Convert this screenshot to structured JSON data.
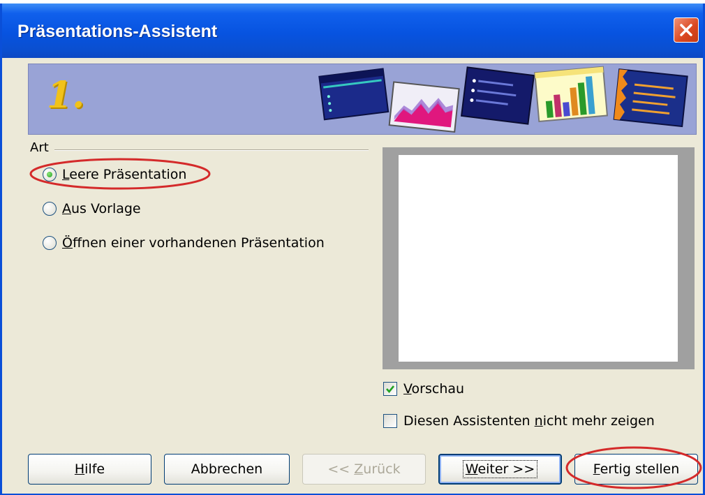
{
  "window": {
    "title": "Präsentations-Assistent"
  },
  "banner": {
    "step_number": "1.",
    "thumbnail_icons": [
      "presentation-dark-blue-slide-icon",
      "area-chart-slide-icon",
      "bullet-list-slide-icon",
      "bar-chart-slide-icon",
      "text-lines-slide-icon"
    ]
  },
  "type_group": {
    "label": "Art",
    "options": [
      {
        "label": "Leere Präsentation",
        "mnemonic_index": 0,
        "checked": true
      },
      {
        "label": "Aus Vorlage",
        "mnemonic_index": 0,
        "checked": false
      },
      {
        "label": "Öffnen einer vorhandenen Präsentation",
        "mnemonic_index": 0,
        "checked": false
      }
    ]
  },
  "preview_checkbox": {
    "label": "Vorschau",
    "checked": true
  },
  "dont_show_checkbox": {
    "label": "Diesen Assistenten nicht mehr zeigen",
    "checked": false
  },
  "buttons": {
    "help": "Hilfe",
    "cancel": "Abbrechen",
    "back": "<< Zurück",
    "next": "Weiter >>",
    "finish": "Fertig stellen"
  },
  "annotations": {
    "highlight_color": "#d42a2a",
    "highlighted": [
      "option-empty-presentation",
      "finish-button"
    ]
  },
  "colors": {
    "title_bar": "#0753e0",
    "dialog_background": "#ece9d8",
    "banner_background": "#99a3d6",
    "preview_frame": "#a0a0a0"
  }
}
